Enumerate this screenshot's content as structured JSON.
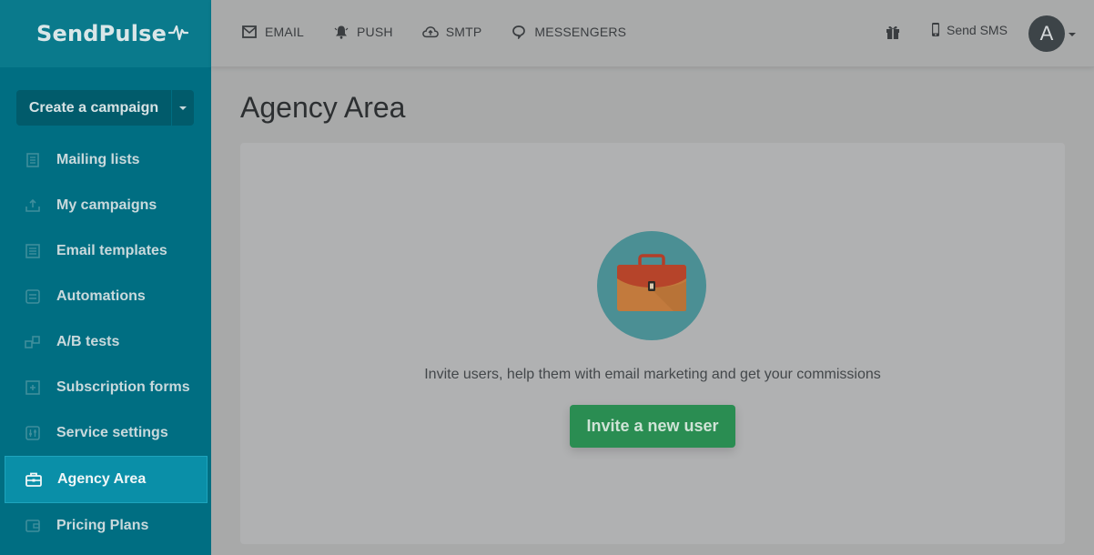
{
  "brand": {
    "name": "SendPulse"
  },
  "sidebar": {
    "create_button": "Create a campaign",
    "items": [
      {
        "label": "Mailing lists",
        "icon": "mailing-lists-icon"
      },
      {
        "label": "My campaigns",
        "icon": "campaigns-icon"
      },
      {
        "label": "Email templates",
        "icon": "templates-icon"
      },
      {
        "label": "Automations",
        "icon": "automations-icon"
      },
      {
        "label": "A/B tests",
        "icon": "ab-tests-icon"
      },
      {
        "label": "Subscription forms",
        "icon": "forms-icon"
      },
      {
        "label": "Service settings",
        "icon": "settings-icon"
      },
      {
        "label": "Agency Area",
        "icon": "briefcase-icon",
        "active": true
      },
      {
        "label": "Pricing Plans",
        "icon": "wallet-icon"
      }
    ]
  },
  "topnav": {
    "items": [
      {
        "label": "EMAIL",
        "icon": "envelope-icon"
      },
      {
        "label": "PUSH",
        "icon": "bell-icon"
      },
      {
        "label": "SMTP",
        "icon": "cloud-upload-icon"
      },
      {
        "label": "MESSENGERS",
        "icon": "chat-icon"
      }
    ],
    "sms_label": "Send SMS",
    "avatar_letter": "A"
  },
  "main": {
    "title": "Agency Area",
    "invite_text": "Invite users, help them with email marketing and get your commissions",
    "invite_button": "Invite a new user"
  },
  "colors": {
    "sidebar_bg": "#006e82",
    "active_item": "#0a8fa8",
    "button_green": "#2a8d52"
  }
}
